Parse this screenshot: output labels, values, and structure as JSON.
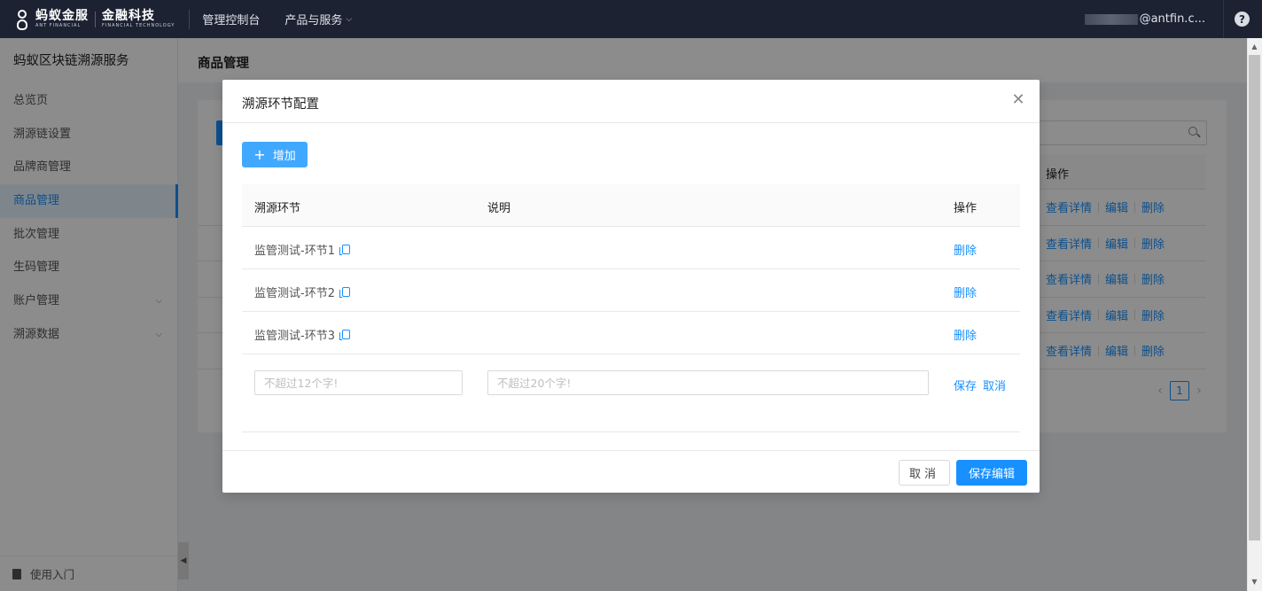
{
  "header": {
    "brand_cn": "蚂蚁金服",
    "brand_en": "ANT FINANCIAL",
    "brand2_cn": "金融科技",
    "brand2_en": "FINANCIAL TECHNOLOGY",
    "nav": [
      "管理控制台",
      "产品与服务"
    ],
    "user_email": "@antfin.c...",
    "help": "?"
  },
  "sidebar": {
    "title": "蚂蚁区块链溯源服务",
    "items": [
      {
        "label": "总览页"
      },
      {
        "label": "溯源链设置"
      },
      {
        "label": "品牌商管理"
      },
      {
        "label": "商品管理",
        "active": true
      },
      {
        "label": "批次管理"
      },
      {
        "label": "生码管理"
      },
      {
        "label": "账户管理",
        "has_children": true
      },
      {
        "label": "溯源数据",
        "has_children": true
      }
    ],
    "footer": "使用入门"
  },
  "page": {
    "title": "商品管理",
    "table_action_header": "操作",
    "row_actions": [
      "查看详情",
      "编辑",
      "删除"
    ],
    "current_page": "1"
  },
  "modal": {
    "title": "溯源环节配置",
    "add_label": "增加",
    "columns": [
      "溯源环节",
      "说明",
      "操作"
    ],
    "rows": [
      {
        "name": "监管测试-环节1",
        "desc": "",
        "action": "删除"
      },
      {
        "name": "监管测试-环节2",
        "desc": "",
        "action": "删除"
      },
      {
        "name": "监管测试-环节3",
        "desc": "",
        "action": "删除"
      }
    ],
    "edit_row": {
      "name_placeholder": "不超过12个字!",
      "desc_placeholder": "不超过20个字!",
      "save": "保存",
      "cancel": "取消"
    },
    "footer": {
      "cancel": "取消",
      "save": "保存编辑"
    }
  },
  "colors": {
    "primary": "#1890ff",
    "topbar": "#1c2232"
  }
}
